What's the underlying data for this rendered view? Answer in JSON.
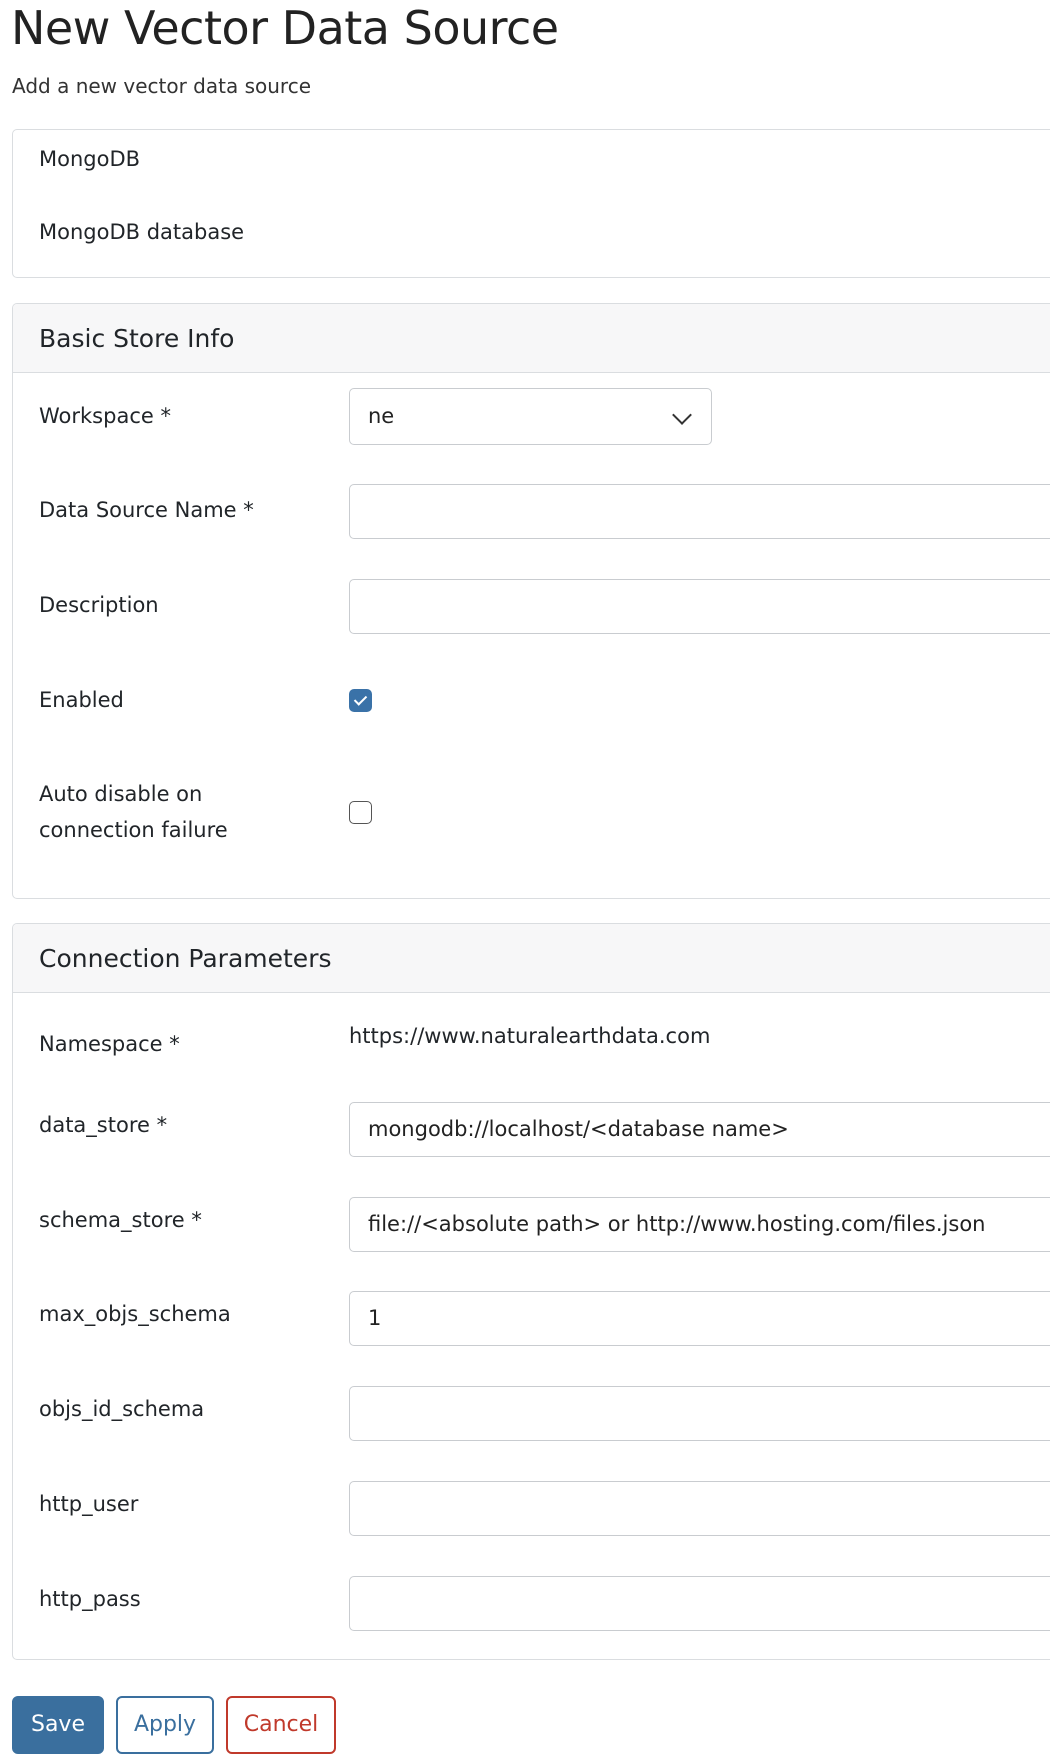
{
  "page": {
    "title": "New Vector Data Source",
    "subtitle": "Add a new vector data source"
  },
  "store": {
    "type": "MongoDB",
    "description": "MongoDB database"
  },
  "basic_info": {
    "header": "Basic Store Info",
    "workspace_label": "Workspace *",
    "workspace_value": "ne",
    "name_label": "Data Source Name *",
    "name_value": "",
    "description_label": "Description",
    "description_value": "",
    "enabled_label": "Enabled",
    "enabled_checked": true,
    "auto_disable_label_line1": "Auto disable on",
    "auto_disable_label_line2": "connection failure",
    "auto_disable_checked": false
  },
  "connection": {
    "header": "Connection Parameters",
    "namespace_label": "Namespace *",
    "namespace_value": "https://www.naturalearthdata.com",
    "data_store_label": "data_store *",
    "data_store_value": "mongodb://localhost/<database name>",
    "schema_store_label": "schema_store *",
    "schema_store_value": "file://<absolute path> or http://www.hosting.com/files.json",
    "max_objs_schema_label": "max_objs_schema",
    "max_objs_schema_value": "1",
    "objs_id_schema_label": "objs_id_schema",
    "objs_id_schema_value": "",
    "http_user_label": "http_user",
    "http_user_value": "",
    "http_pass_label": "http_pass",
    "http_pass_value": ""
  },
  "actions": {
    "save": "Save",
    "apply": "Apply",
    "cancel": "Cancel"
  },
  "colors": {
    "primary": "#3a6f9e",
    "danger": "#c0392b",
    "checkbox_checked": "#3a72a8"
  }
}
